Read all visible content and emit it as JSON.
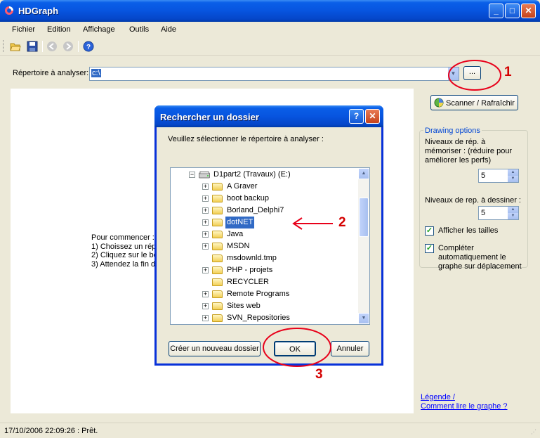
{
  "window": {
    "title": "HDGraph"
  },
  "menu": [
    "Fichier",
    "Edition",
    "Affichage",
    "Outils",
    "Aide"
  ],
  "toolbar": {
    "icons": [
      "open-folder-icon",
      "save-icon",
      "back-icon",
      "forward-icon",
      "help-icon"
    ]
  },
  "directory": {
    "label": "Répertoire à analyser:",
    "value": "c:\\",
    "browse_label": "..."
  },
  "main": {
    "start_text": "Pour commencer :\n1) Choissez un rép\n2) Cliquez sur le bou\n3) Attendez la fin de"
  },
  "right_panel": {
    "scan_button": "Scanner / Rafraîchir",
    "group_title": "Drawing options",
    "mem_levels_label": "Niveaux de rép. à mémoriser : (réduire pour améliorer les perfs)",
    "mem_levels_value": "5",
    "draw_levels_label": "Niveaux de rep. à dessiner :",
    "draw_levels_value": "5",
    "show_sizes_label": "Afficher les tailles",
    "show_sizes_checked": true,
    "autocomplete_label": "Compléter automatiquement le graphe sur déplacement",
    "autocomplete_checked": true,
    "legend_link": "Légende /",
    "howto_link": "Comment lire le graphe ?"
  },
  "status": {
    "text": "17/10/2006 22:09:26 : Prêt."
  },
  "dialog": {
    "title": "Rechercher un dossier",
    "prompt": "Veuillez sélectionner le répertoire à analyser :",
    "drive": "D1part2 (Travaux) (E:)",
    "folders": [
      {
        "name": "A Graver",
        "expandable": true,
        "selected": false
      },
      {
        "name": "boot backup",
        "expandable": true,
        "selected": false
      },
      {
        "name": "Borland_Delphi7",
        "expandable": true,
        "selected": false
      },
      {
        "name": "dotNET",
        "expandable": true,
        "selected": true
      },
      {
        "name": "Java",
        "expandable": true,
        "selected": false
      },
      {
        "name": "MSDN",
        "expandable": true,
        "selected": false
      },
      {
        "name": "msdownld.tmp",
        "expandable": false,
        "selected": false
      },
      {
        "name": "PHP - projets",
        "expandable": true,
        "selected": false
      },
      {
        "name": "RECYCLER",
        "expandable": false,
        "selected": false
      },
      {
        "name": "Remote Programs",
        "expandable": true,
        "selected": false
      },
      {
        "name": "Sites web",
        "expandable": true,
        "selected": false
      },
      {
        "name": "SVN_Repositories",
        "expandable": true,
        "selected": false
      }
    ],
    "new_folder_button": "Créer un nouveau dossier",
    "ok_button": "OK",
    "cancel_button": "Annuler",
    "help_button": "?",
    "close_button": "✕"
  },
  "annotations": [
    "1",
    "2",
    "3"
  ],
  "colors": {
    "annotation": "#e8001a",
    "selection": "#316ac5",
    "title_bar": "#0754df",
    "link": "#0000ff"
  }
}
